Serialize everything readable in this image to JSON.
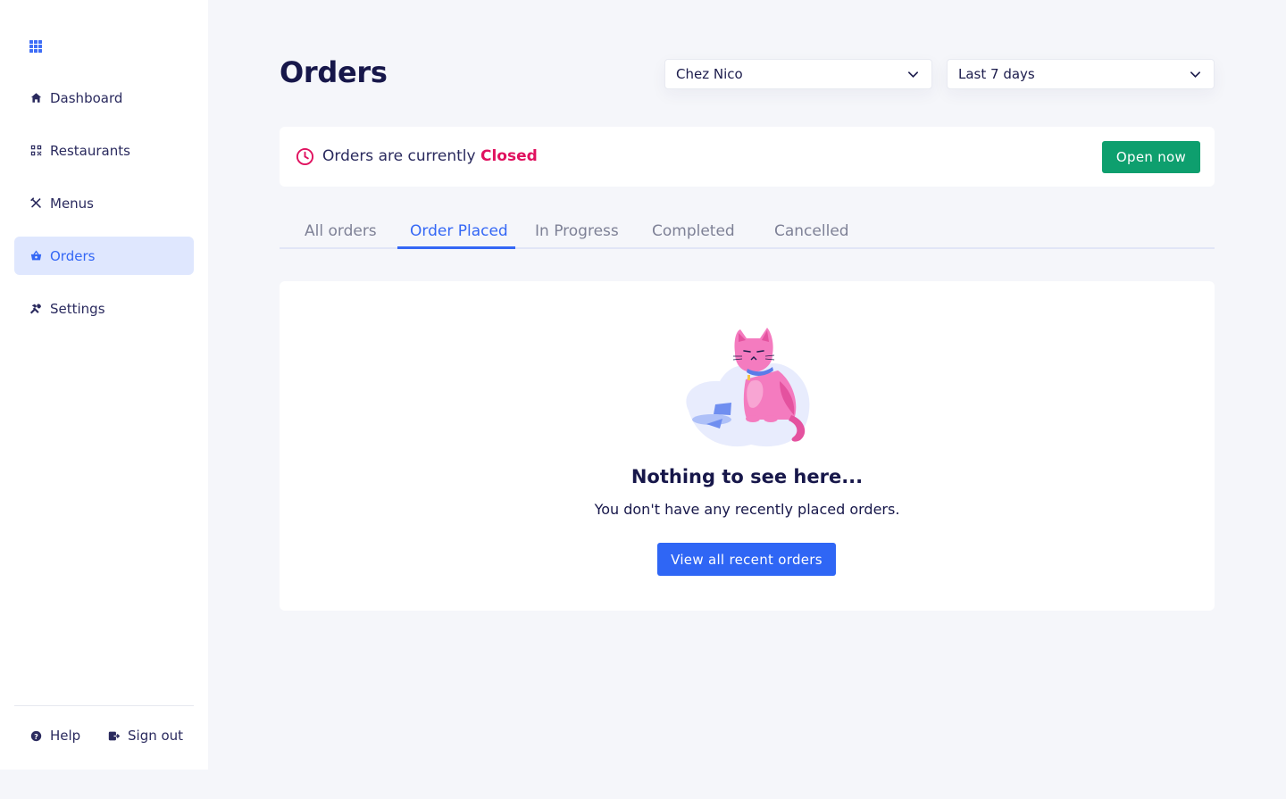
{
  "sidebar": {
    "logo_icon": "grid-icon",
    "items": [
      {
        "label": "Dashboard",
        "icon": "home-icon"
      },
      {
        "label": "Restaurants",
        "icon": "qr-code-icon"
      },
      {
        "label": "Menus",
        "icon": "utensils-icon"
      },
      {
        "label": "Orders",
        "icon": "basket-icon",
        "active": true
      },
      {
        "label": "Settings",
        "icon": "tools-icon"
      }
    ],
    "footer": {
      "help_label": "Help",
      "signout_label": "Sign out"
    }
  },
  "header": {
    "title": "Orders",
    "restaurant_select": {
      "value": "Chez Nico"
    },
    "period_select": {
      "value": "Last 7 days"
    }
  },
  "status": {
    "prefix": "Orders are currently",
    "state": "Closed",
    "action_label": "Open now"
  },
  "tabs": [
    {
      "label": "All orders"
    },
    {
      "label": "Order Placed",
      "active": true
    },
    {
      "label": "In Progress"
    },
    {
      "label": "Completed"
    },
    {
      "label": "Cancelled"
    }
  ],
  "empty_state": {
    "title": "Nothing to see here...",
    "subtitle": "You don't have any recently placed orders.",
    "button_label": "View all recent orders"
  },
  "colors": {
    "accent": "#3467f5",
    "active_bg": "#dfe7fe",
    "closed": "#e0115f",
    "success": "#0e9f6e",
    "title": "#17174a"
  }
}
